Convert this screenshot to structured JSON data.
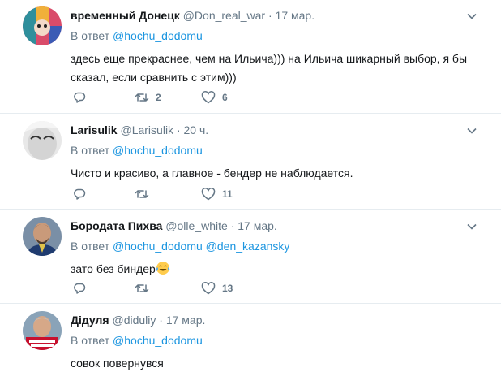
{
  "tweets": [
    {
      "name": "временный Донецк",
      "handle": "@Don_real_war",
      "separator": "·",
      "time": "17 мар.",
      "reply_prefix": "В ответ",
      "reply_to": [
        "@hochu_dodomu"
      ],
      "text_lines": [
        "здесь еще прекраснее, чем на Ильича))) на Ильича шикарный выбор, я бы",
        "сказал, если сравнить с этим)))"
      ],
      "retweets": "2",
      "likes": "6"
    },
    {
      "name": "Larisulik",
      "handle": "@Larisulik",
      "separator": "·",
      "time": "20 ч.",
      "reply_prefix": "В ответ",
      "reply_to": [
        "@hochu_dodomu"
      ],
      "text_lines": [
        "Чисто и красиво, а главное - бендер не наблюдается."
      ],
      "retweets": "",
      "likes": "11"
    },
    {
      "name": "Бородата Пихва",
      "handle": "@olle_white",
      "separator": "·",
      "time": "17 мар.",
      "reply_prefix": "В ответ",
      "reply_to": [
        "@hochu_dodomu",
        "@den_kazansky"
      ],
      "text_lines": [
        "зато без биндер"
      ],
      "emoji": "face-with-tears-of-joy-icon",
      "retweets": "",
      "likes": "13"
    },
    {
      "name": "Дідуля",
      "handle": "@diduliy",
      "separator": "·",
      "time": "17 мар.",
      "reply_prefix": "В ответ",
      "reply_to": [
        "@hochu_dodomu"
      ],
      "text_lines": [
        "совок повернувся"
      ]
    }
  ],
  "colors": {
    "link": "#1b95e0",
    "meta": "#657786",
    "text": "#14171a",
    "divider": "#e6ecf0"
  }
}
